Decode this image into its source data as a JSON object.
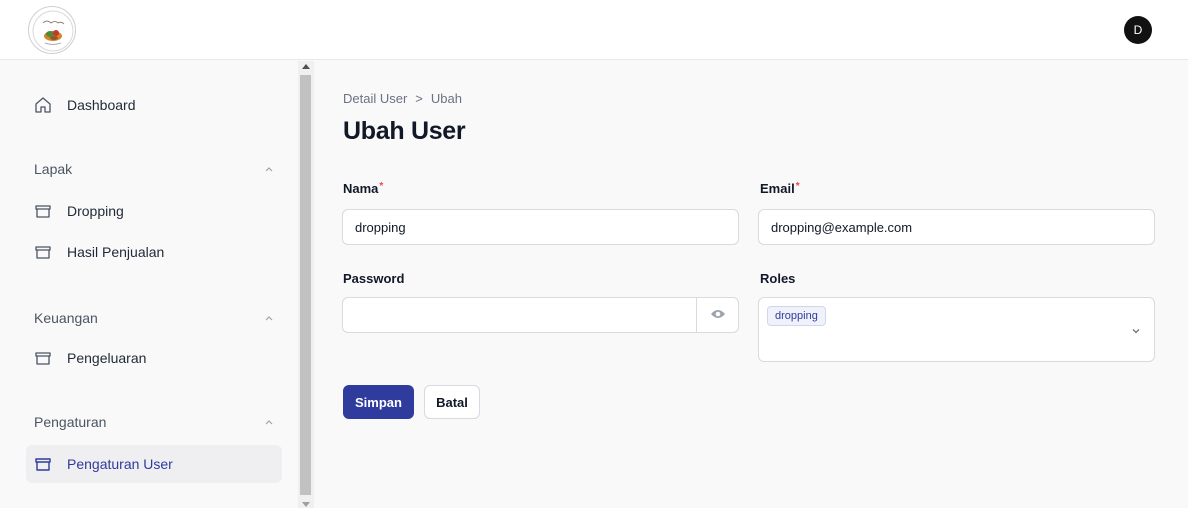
{
  "header": {
    "avatar_initial": "D"
  },
  "sidebar": {
    "dashboard": "Dashboard",
    "sections": [
      {
        "title": "Lapak",
        "items": [
          "Dropping",
          "Hasil Penjualan"
        ]
      },
      {
        "title": "Keuangan",
        "items": [
          "Pengeluaran"
        ]
      },
      {
        "title": "Pengaturan",
        "items": [
          "Pengaturan User"
        ]
      }
    ]
  },
  "main": {
    "breadcrumb": {
      "parent": "Detail User",
      "separator": ">",
      "current": "Ubah"
    },
    "title": "Ubah User",
    "form": {
      "nama_label": "Nama",
      "nama_value": "dropping",
      "email_label": "Email",
      "email_value": "dropping@example.com",
      "password_label": "Password",
      "password_value": "",
      "roles_label": "Roles",
      "roles_selected": "dropping",
      "required_mark": "*"
    },
    "buttons": {
      "save": "Simpan",
      "cancel": "Batal"
    }
  },
  "colors": {
    "primary": "#2f3c9e",
    "active_text": "#2e3a9c",
    "required": "#ef4444"
  }
}
